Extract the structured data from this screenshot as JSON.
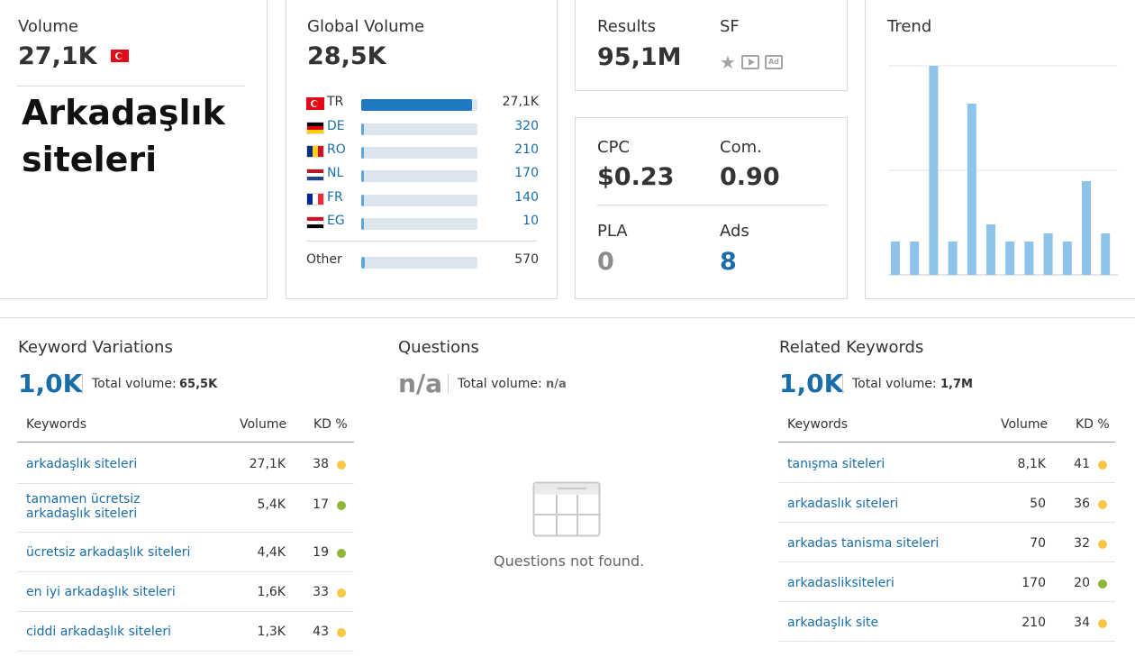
{
  "volume_card": {
    "label": "Volume",
    "value": "27,1K",
    "flag": "TR",
    "keyword": "Arkadaşlık siteleri"
  },
  "global_volume": {
    "label": "Global Volume",
    "value": "28,5K",
    "countries": [
      {
        "code": "TR",
        "value": "27,1K",
        "share": 0.95
      },
      {
        "code": "DE",
        "value": "320",
        "share": 0.02
      },
      {
        "code": "RO",
        "value": "210",
        "share": 0.015
      },
      {
        "code": "NL",
        "value": "170",
        "share": 0.012
      },
      {
        "code": "FR",
        "value": "140",
        "share": 0.01
      },
      {
        "code": "EG",
        "value": "10",
        "share": 0.005
      }
    ],
    "other": {
      "label": "Other",
      "value": "570",
      "share": 0.03
    }
  },
  "results_card": {
    "results_label": "Results",
    "results_value": "95,1M",
    "sf_label": "SF",
    "sf_icons": [
      "star-icon",
      "video-icon",
      "ad-icon"
    ],
    "ad_text": "Ad"
  },
  "cpc_card": {
    "cpc_label": "CPC",
    "cpc_value": "$0.23",
    "com_label": "Com.",
    "com_value": "0.90",
    "pla_label": "PLA",
    "pla_value": "0",
    "ads_label": "Ads",
    "ads_value": "8"
  },
  "trend": {
    "label": "Trend",
    "values": [
      0.16,
      0.16,
      1.0,
      0.16,
      0.82,
      0.24,
      0.16,
      0.16,
      0.2,
      0.16,
      0.45,
      0.2
    ]
  },
  "keyword_variations": {
    "title": "Keyword Variations",
    "count": "1,0K",
    "total_label": "Total volume:",
    "total_value": "65,5K",
    "headers": {
      "keyword": "Keywords",
      "volume": "Volume",
      "kd": "KD %"
    },
    "rows": [
      {
        "keyword": "arkadaşlık siteleri",
        "volume": "27,1K",
        "kd": "38",
        "kd_color": "#f6c844"
      },
      {
        "keyword": "tamamen ücretsiz arkadaşlık siteleri",
        "volume": "5,4K",
        "kd": "17",
        "kd_color": "#8fb63a"
      },
      {
        "keyword": "ücretsiz arkadaşlık siteleri",
        "volume": "4,4K",
        "kd": "19",
        "kd_color": "#8fb63a"
      },
      {
        "keyword": "en iyi arkadaşlık siteleri",
        "volume": "1,6K",
        "kd": "33",
        "kd_color": "#f6c844"
      },
      {
        "keyword": "ciddi arkadaşlık siteleri",
        "volume": "1,3K",
        "kd": "43",
        "kd_color": "#f6c844"
      }
    ]
  },
  "questions": {
    "title": "Questions",
    "count": "n/a",
    "total_label": "Total volume:",
    "total_value": "n/a",
    "empty_text": "Questions not found."
  },
  "related_keywords": {
    "title": "Related Keywords",
    "count": "1,0K",
    "total_label": "Total volume:",
    "total_value": "1,7M",
    "headers": {
      "keyword": "Keywords",
      "volume": "Volume",
      "kd": "KD %"
    },
    "rows": [
      {
        "keyword": "tanışma siteleri",
        "volume": "8,1K",
        "kd": "41",
        "kd_color": "#f6c844"
      },
      {
        "keyword": "arkadaslık sıteleri",
        "volume": "50",
        "kd": "36",
        "kd_color": "#f6c844"
      },
      {
        "keyword": "arkadas tanisma siteleri",
        "volume": "70",
        "kd": "32",
        "kd_color": "#f6c844"
      },
      {
        "keyword": "arkadasliksiteleri",
        "volume": "170",
        "kd": "20",
        "kd_color": "#8fb63a"
      },
      {
        "keyword": "arkadaşlık site",
        "volume": "210",
        "kd": "34",
        "kd_color": "#f6c844"
      }
    ]
  }
}
